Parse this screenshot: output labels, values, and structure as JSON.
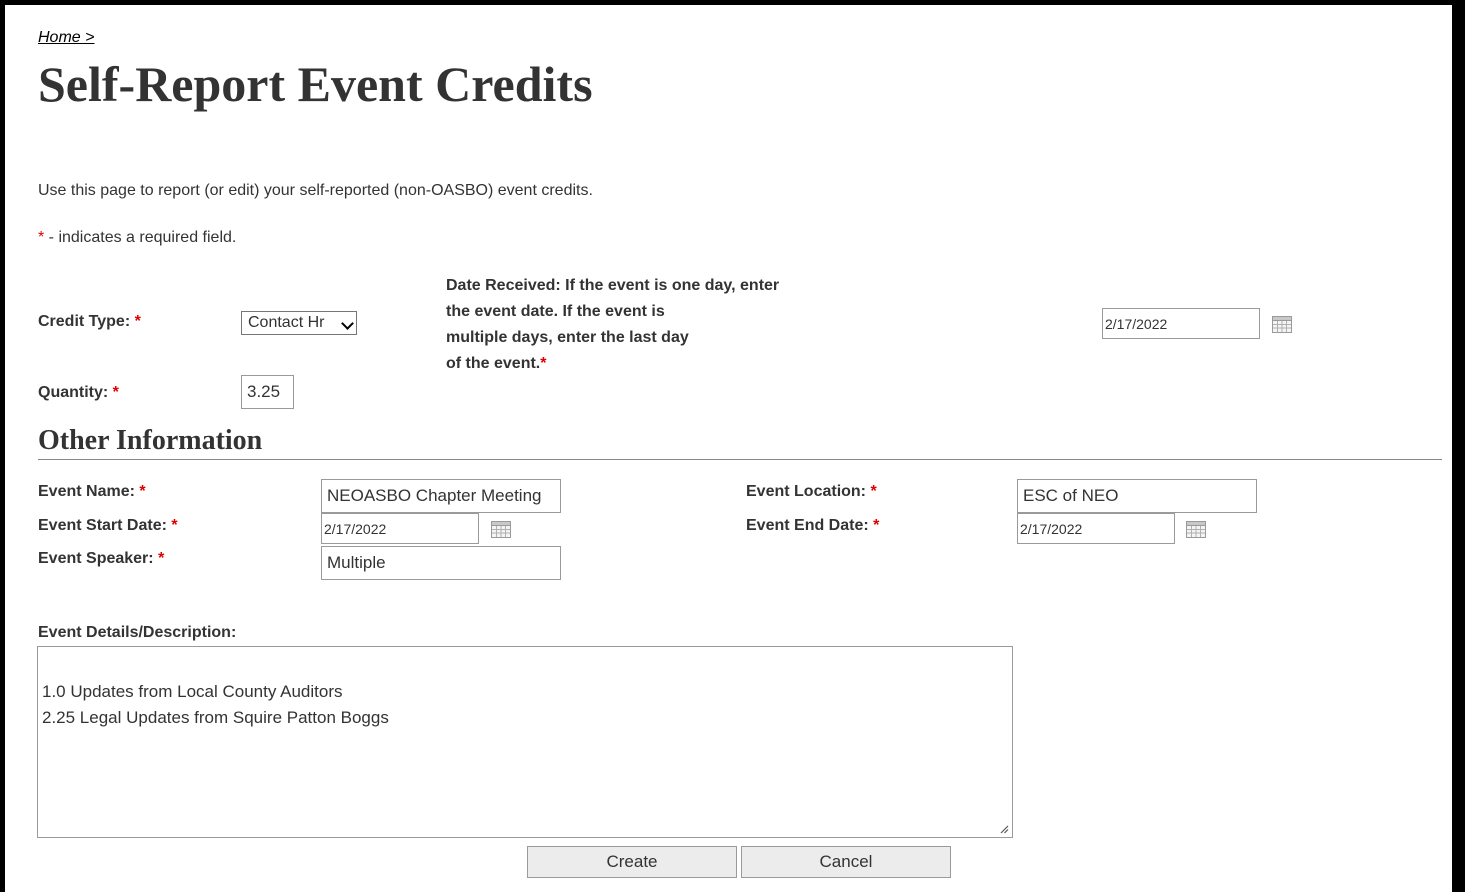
{
  "breadcrumb": {
    "home": "Home >"
  },
  "page": {
    "title": "Self-Report Event Credits",
    "intro": "Use this page to report (or edit) your self-reported (non-OASBO) event credits.",
    "required_star": "*",
    "required_note": " - indicates a required field."
  },
  "form": {
    "credit_type": {
      "label": "Credit Type:",
      "value": "Contact Hr"
    },
    "date_received": {
      "label": "Date Received: If the event is one day, enter\n the event date. If the event is\nmultiple days, enter the last day\nof the event.",
      "value": "2/17/2022"
    },
    "quantity": {
      "label": "Quantity:",
      "value": "3.25"
    }
  },
  "other": {
    "heading": "Other Information",
    "event_name": {
      "label": "Event Name:",
      "value": "NEOASBO Chapter Meeting"
    },
    "event_location": {
      "label": "Event Location:",
      "value": "ESC of NEO"
    },
    "event_start": {
      "label": "Event Start Date:",
      "value": "2/17/2022"
    },
    "event_end": {
      "label": "Event End Date:",
      "value": "2/17/2022"
    },
    "event_speaker": {
      "label": "Event Speaker:",
      "value": "Multiple"
    },
    "details": {
      "label": "Event Details/Description:",
      "value": "1.0   Updates from Local County Auditors\n2.25 Legal Updates from Squire Patton Boggs"
    }
  },
  "buttons": {
    "create": "Create",
    "cancel": "Cancel"
  },
  "icons": {
    "calendar": "calendar-icon",
    "chevron": "chevron-down-icon",
    "resize": "resize-grip-icon"
  },
  "colors": {
    "required": "#e00000",
    "text": "#333333"
  }
}
